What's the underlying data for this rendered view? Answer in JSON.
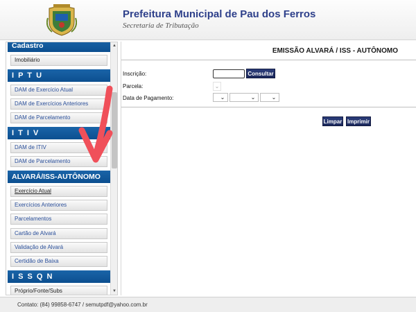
{
  "header": {
    "title": "Prefeitura Municipal de Pau dos Ferros",
    "subtitle": "Secretaria de Tributação"
  },
  "sidebar": {
    "sections": [
      {
        "title": "Cadastro",
        "items": [
          "Imobiliário"
        ]
      },
      {
        "title": "I P T U",
        "items": [
          "DAM de Exercício Atual",
          "DAM de Exercícios Anteriores",
          "DAM de Parcelamento"
        ]
      },
      {
        "title": "I T I V",
        "items": [
          "DAM de ITIV",
          "DAM de Parcelamento"
        ]
      },
      {
        "title": "ALVARÁ/ISS-AUTÔNOMO",
        "items": [
          "Exercício Atual",
          "Exercícios Anteriores",
          "Parcelamentos",
          "Cartão de Alvará",
          "Validação de Alvará",
          "Certidão de Baixa"
        ]
      },
      {
        "title": "I S S Q N",
        "items": [
          "Próprio/Fonte/Subs"
        ]
      }
    ]
  },
  "main": {
    "title": "EMISSÃO ALVARÁ / ISS - AUTÔNOMO",
    "form": {
      "inscricao_label": "Inscrição:",
      "inscricao_value": "",
      "consultar_label": "Consultar",
      "parcela_label": "Parcela:",
      "data_pagamento_label": "Data de Pagamento:"
    },
    "buttons": {
      "limpar": "Limpar",
      "imprimir": "Imprimir"
    }
  },
  "footer": {
    "text": "Contato: (84) 99858-6747 / semutpdf@yahoo.com.br"
  },
  "colors": {
    "brand_blue": "#2d3f8a",
    "section_blue": "#0c4f90",
    "button_navy": "#1b285c",
    "annotation_red": "#f0505a"
  },
  "icons": {
    "crest": "municipal-crest-icon",
    "caret": "chevron-down-icon",
    "annotation": "red-arrow-annotation"
  }
}
